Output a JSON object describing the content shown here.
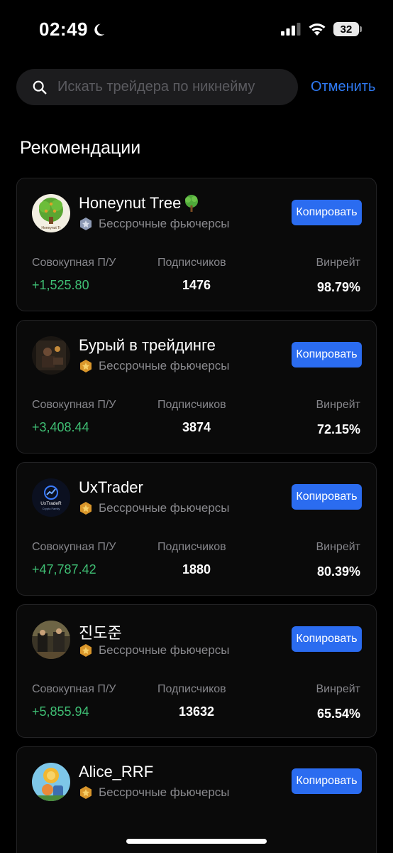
{
  "status_bar": {
    "time": "02:49",
    "battery": "32"
  },
  "search": {
    "placeholder": "Искать трейдера по никнейму",
    "value": "",
    "cancel_label": "Отменить"
  },
  "section_title": "Рекомендации",
  "labels": {
    "pnl": "Совокупная П/У",
    "subscribers": "Подписчиков",
    "winrate": "Винрейт",
    "copy": "Копировать"
  },
  "colors": {
    "accent": "#2b6cf0",
    "profit": "#3fbf74",
    "link": "#2f7bf6"
  },
  "traders": [
    {
      "name": "Honeynut Tree",
      "badge": "Бессрочные фьючерсы",
      "pnl": "+1,525.80",
      "subscribers": "1476",
      "winrate": "98.79%",
      "badge_tier": "silver"
    },
    {
      "name": "Бурый в трейдинге",
      "badge": "Бессрочные фьючерсы",
      "pnl": "+3,408.44",
      "subscribers": "3874",
      "winrate": "72.15%",
      "badge_tier": "gold"
    },
    {
      "name": "UxTrader",
      "badge": "Бессрочные фьючерсы",
      "pnl": "+47,787.42",
      "subscribers": "1880",
      "winrate": "80.39%",
      "badge_tier": "gold"
    },
    {
      "name": "진도준",
      "badge": "Бессрочные фьючерсы",
      "pnl": "+5,855.94",
      "subscribers": "13632",
      "winrate": "65.54%",
      "badge_tier": "gold"
    },
    {
      "name": "Alice_RRF",
      "badge": "Бессрочные фьючерсы",
      "pnl": "",
      "subscribers": "",
      "winrate": "",
      "badge_tier": "gold"
    }
  ],
  "avatar_texts": {
    "honeynut": "Honeynut Tr",
    "uxtrader_1": "UxTradeR",
    "uxtrader_2": "Crypto Family"
  }
}
